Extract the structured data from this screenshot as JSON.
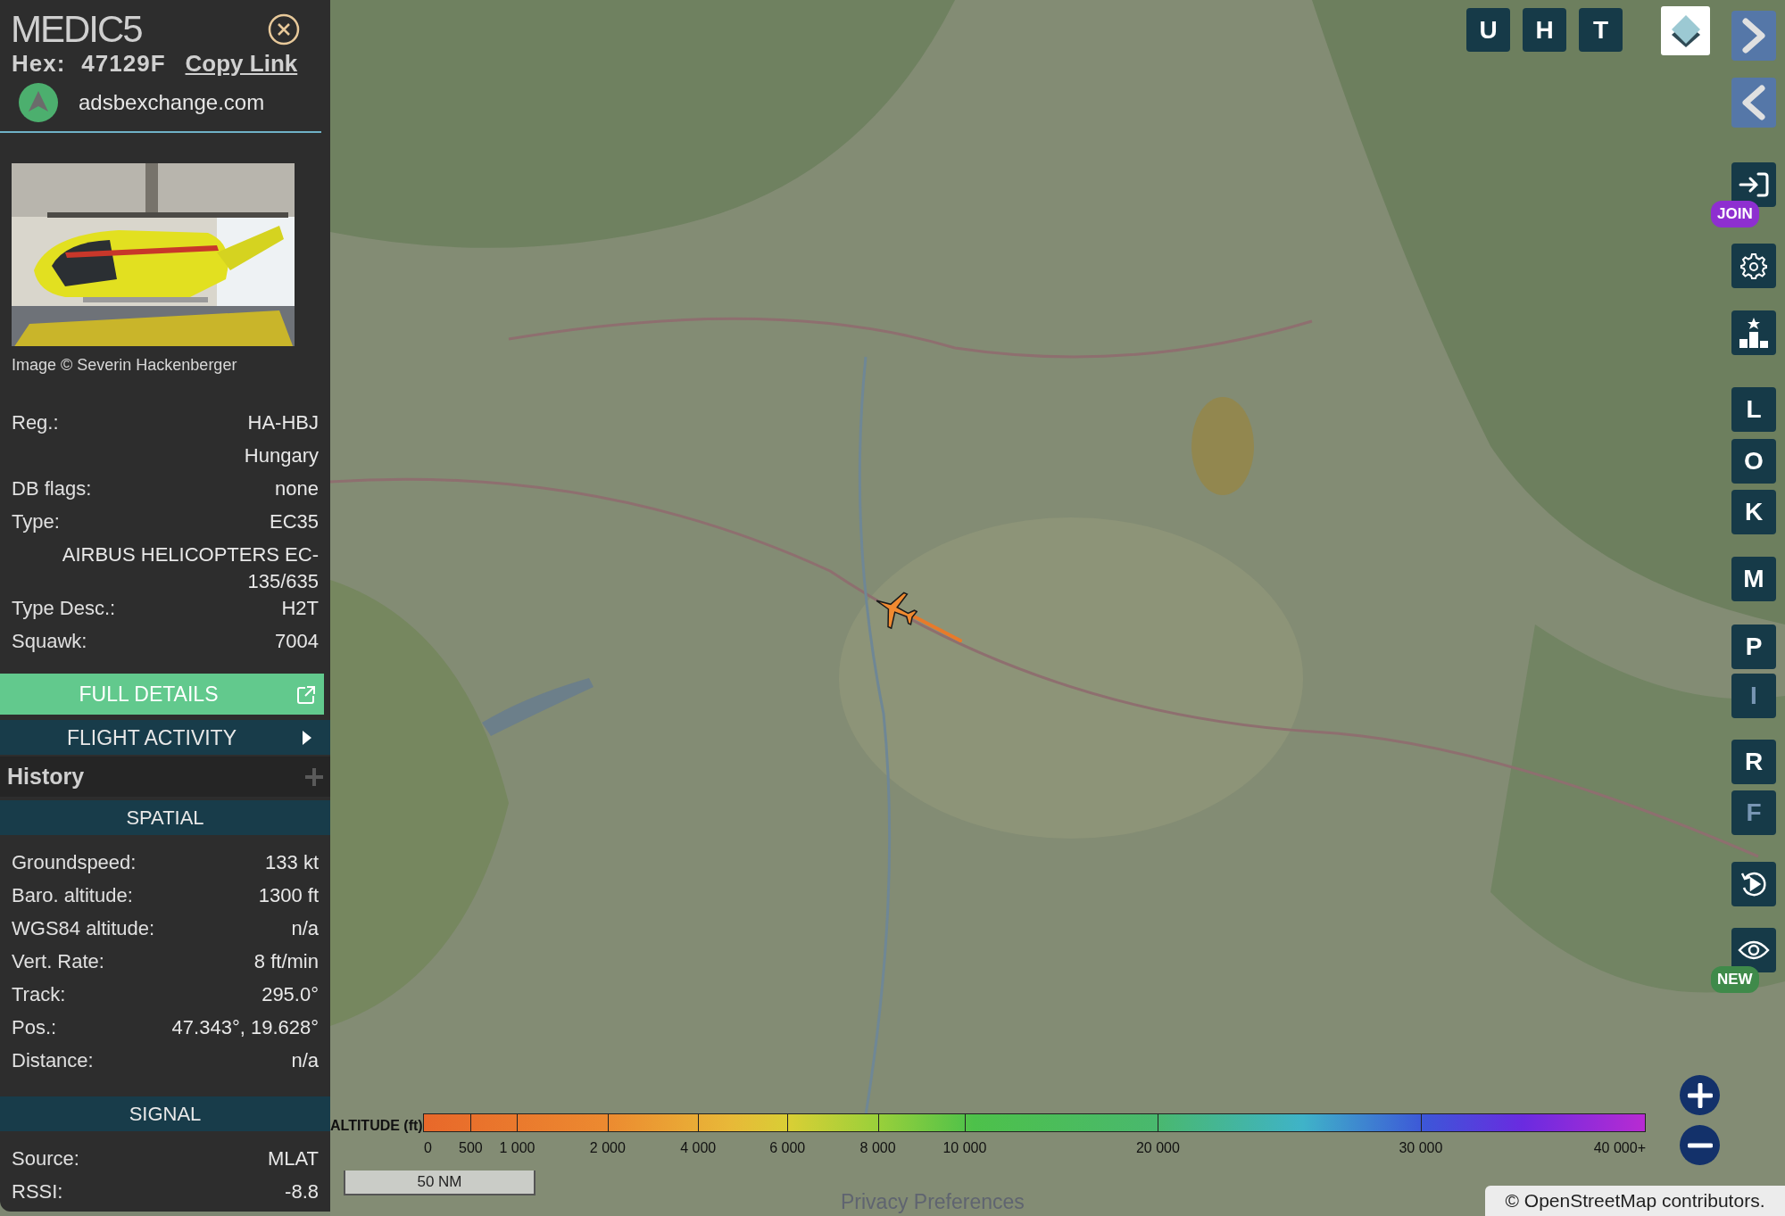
{
  "panel": {
    "callsign": "MEDIC5",
    "hex_label": "Hex:",
    "hex": "47129F",
    "copy_link": "Copy Link",
    "source_site": "adsbexchange.com",
    "photo_credit": "Image © Severin Hackenberger",
    "aircraft_rows": [
      {
        "label": "Reg.:",
        "value": "HA-HBJ"
      },
      {
        "value": "Hungary"
      },
      {
        "label": "DB flags:",
        "value": "none"
      },
      {
        "label": "Type:",
        "value": "EC35"
      },
      {
        "value": "AIRBUS HELICOPTERS EC-135/635"
      },
      {
        "label": "Type Desc.:",
        "value": "H2T"
      },
      {
        "label": "Squawk:",
        "value": "7004"
      }
    ],
    "full_details": "FULL DETAILS",
    "flight_activity": "FLIGHT ACTIVITY",
    "history": {
      "title": "History",
      "expanded": false
    },
    "sections": [
      {
        "title": "SPATIAL",
        "rows": [
          {
            "label": "Groundspeed:",
            "value": "133 kt"
          },
          {
            "label": "Baro. altitude:",
            "value": "1300 ft"
          },
          {
            "label": "WGS84 altitude:",
            "value": "n/a"
          },
          {
            "label": "Vert. Rate:",
            "value": "8 ft/min"
          },
          {
            "label": "Track:",
            "value": "295.0°"
          },
          {
            "label": "Pos.:",
            "value": "47.343°, 19.628°"
          },
          {
            "label": "Distance:",
            "value": "n/a"
          }
        ]
      },
      {
        "title": "SIGNAL",
        "rows": [
          {
            "label": "Source:",
            "value": "MLAT"
          },
          {
            "label": "RSSI:",
            "value": "-8.8"
          }
        ]
      }
    ]
  },
  "map": {
    "top_buttons": [
      {
        "label": "U"
      },
      {
        "label": "H"
      },
      {
        "label": "T"
      }
    ],
    "side_toolbar": [
      {
        "kind": "next"
      },
      {
        "kind": "prev"
      },
      {
        "kind": "login",
        "badge": "JOIN"
      },
      {
        "kind": "settings"
      },
      {
        "kind": "leaderboard"
      },
      {
        "kind": "letter",
        "label": "L",
        "active": true
      },
      {
        "kind": "letter",
        "label": "O",
        "active": true
      },
      {
        "kind": "letter",
        "label": "K",
        "active": true
      },
      {
        "kind": "letter",
        "label": "M",
        "active": true
      },
      {
        "kind": "letter",
        "label": "P",
        "active": true
      },
      {
        "kind": "letter",
        "label": "I",
        "active": false
      },
      {
        "kind": "letter",
        "label": "R",
        "active": true
      },
      {
        "kind": "letter",
        "label": "F",
        "active": false
      },
      {
        "kind": "replay"
      },
      {
        "kind": "view",
        "badge": "NEW"
      }
    ],
    "altitude_legend": {
      "title": "ALTITUDE (ft)",
      "ticks": [
        "0",
        "500",
        "1 000",
        "2 000",
        "4 000",
        "6 000",
        "8 000",
        "10 000",
        "20 000",
        "30 000",
        "40 000+"
      ]
    },
    "scale_bar": "50 NM",
    "privacy_link": "Privacy Preferences",
    "attribution": "© OpenStreetMap contributors."
  }
}
